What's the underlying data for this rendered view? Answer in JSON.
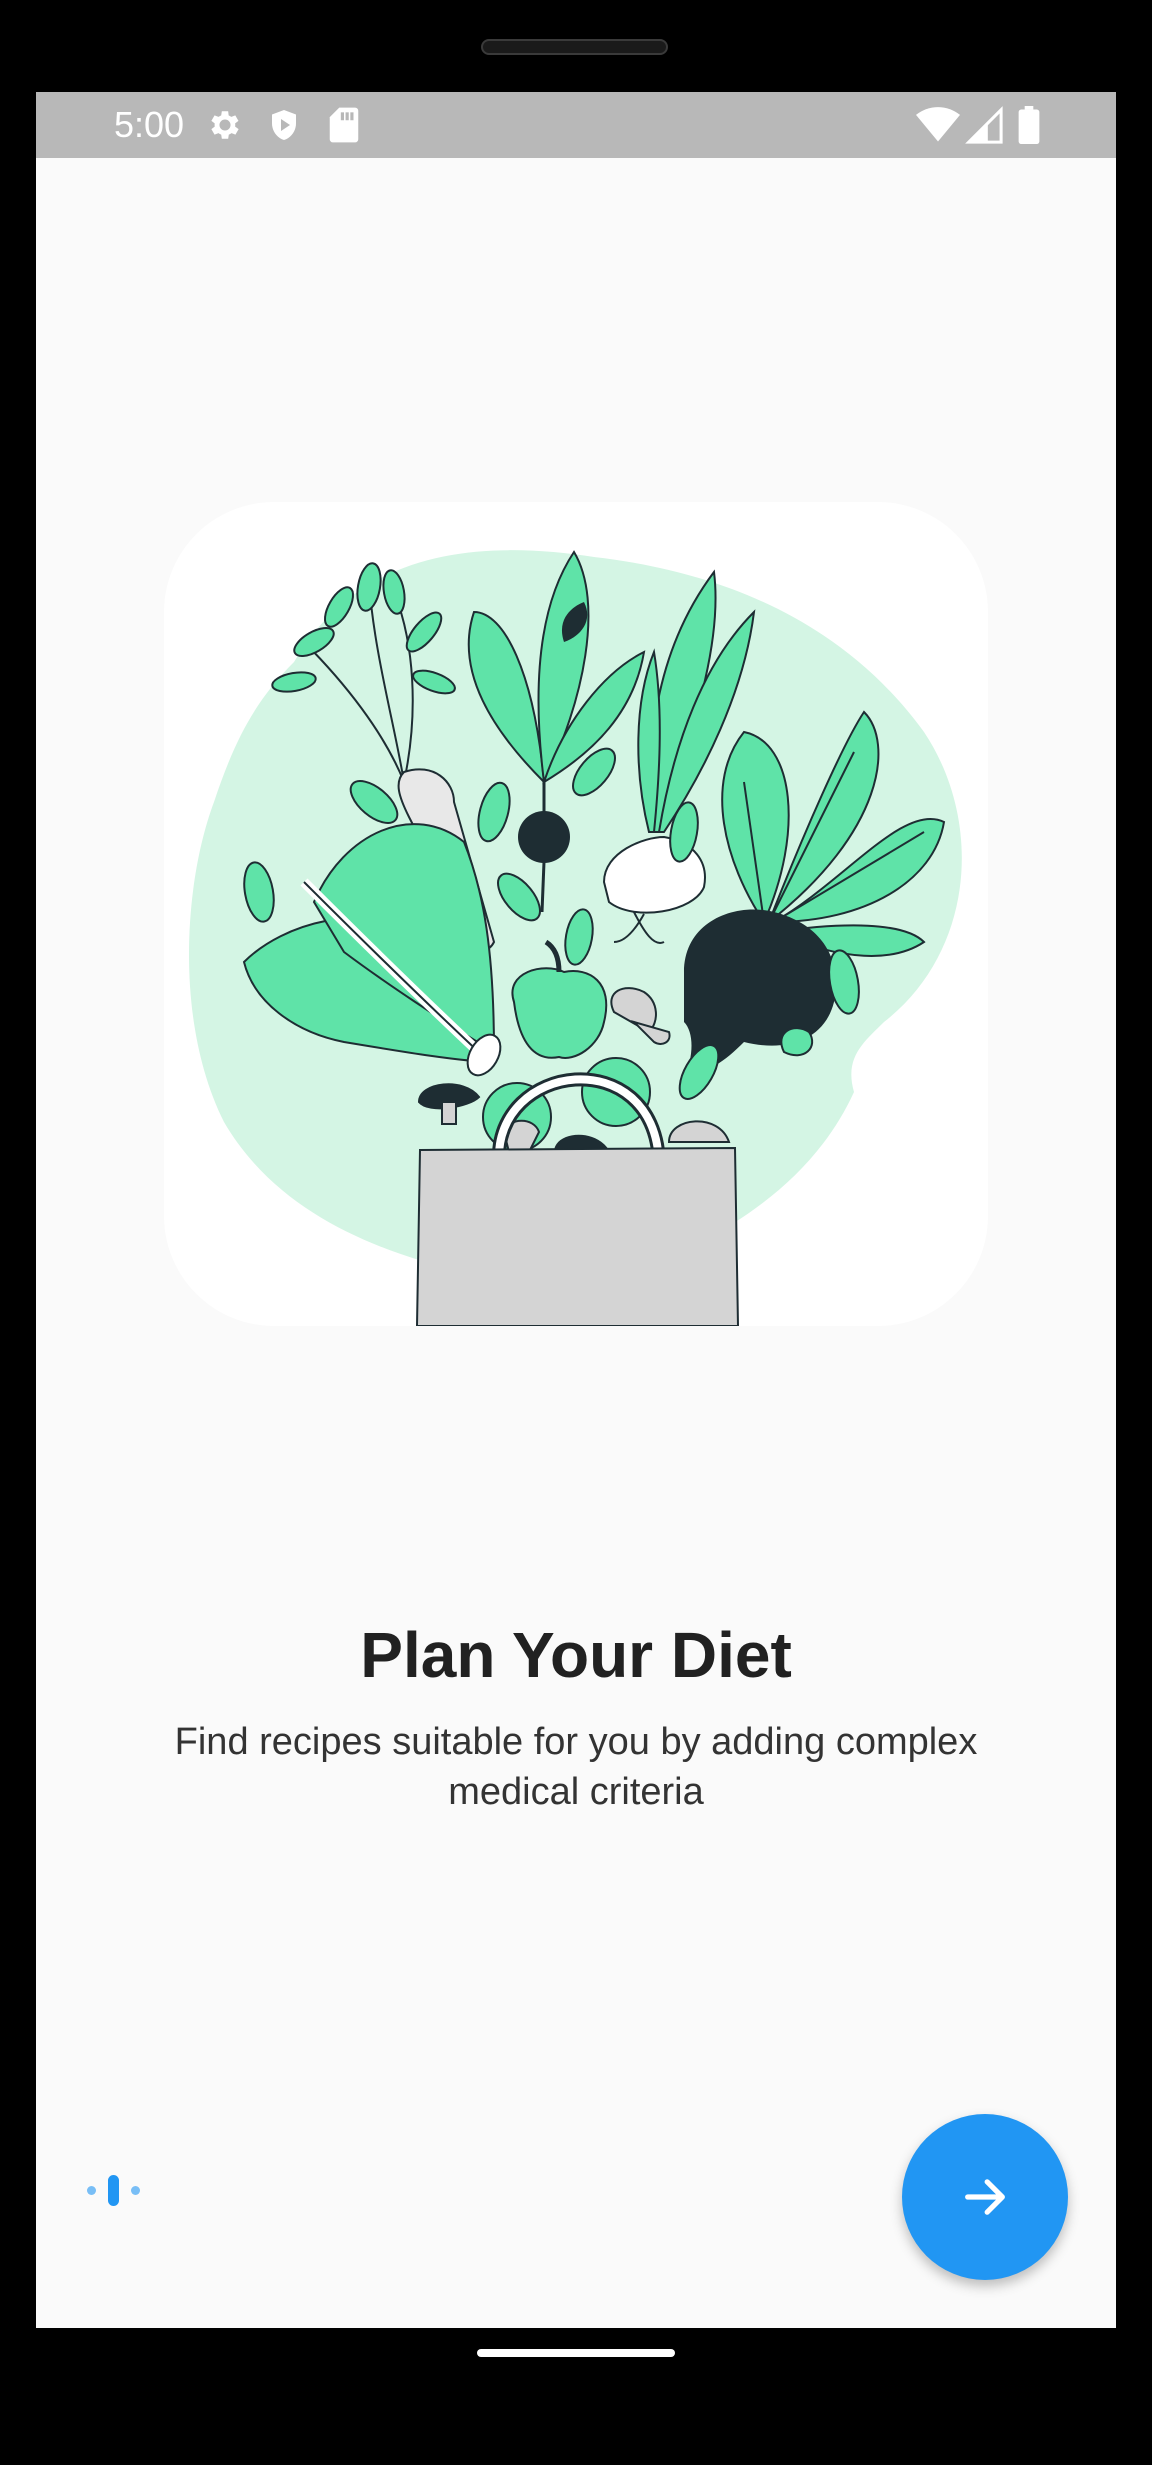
{
  "status_bar": {
    "time": "5:00",
    "left_icons": [
      "settings-icon",
      "shield-play-icon",
      "sd-card-icon"
    ],
    "right_icons": [
      "wifi-icon",
      "cellular-signal-icon",
      "battery-icon"
    ]
  },
  "onboarding": {
    "title": "Plan Your Diet",
    "subtitle": "Find recipes suitable for you by adding complex medical criteria",
    "page_count": 3,
    "current_page": 2,
    "next_button_icon": "arrow-right-icon"
  },
  "colors": {
    "accent": "#2196f3",
    "illustration_mint": "#d4f5e4",
    "leaf_green": "#5fe3a8",
    "dark": "#1e2d33",
    "bag_gray": "#d4d4d4",
    "status_bar": "#b8b8b8",
    "background": "#fafafa"
  }
}
